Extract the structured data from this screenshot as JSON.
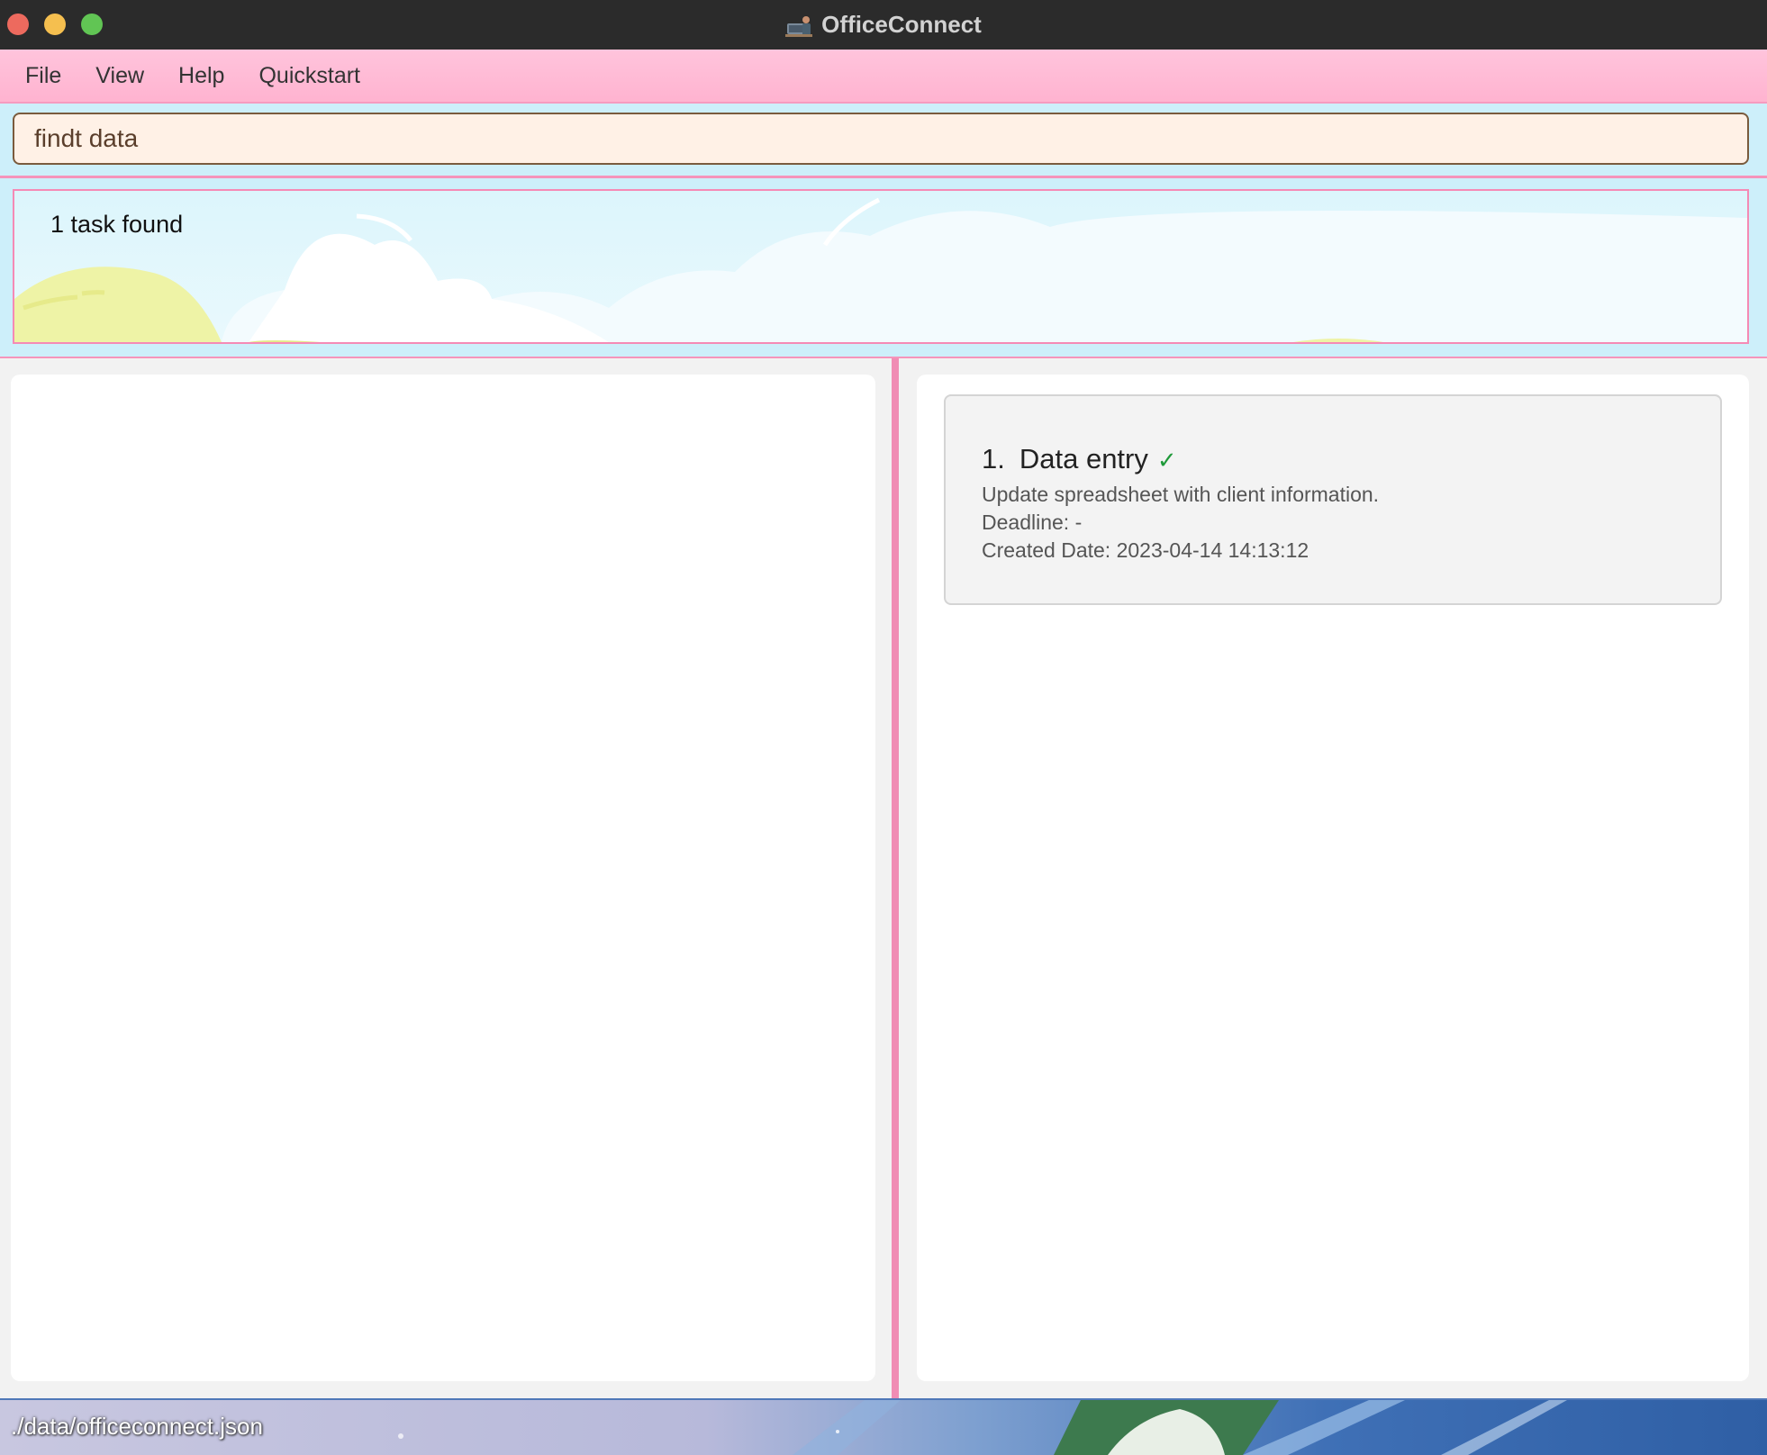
{
  "window": {
    "title": "OfficeConnect"
  },
  "menu": [
    "File",
    "View",
    "Help",
    "Quickstart"
  ],
  "command": {
    "value": "findt data"
  },
  "result": {
    "message": "1 task found"
  },
  "tasks": [
    {
      "index": "1.",
      "title": "Data entry",
      "status_mark": "✓",
      "description": "Update spreadsheet with client information.",
      "deadline": "Deadline: -",
      "created": "Created Date: 2023-04-14 14:13:12"
    }
  ],
  "status": {
    "path": "./data/officeconnect.json"
  },
  "colors": {
    "accent_pink": "#f08db4",
    "command_bg": "#cdeffa",
    "check_green": "#1f9a3a"
  },
  "icons": [
    "close-window-icon",
    "minimize-window-icon",
    "maximize-window-icon",
    "app-logo-icon",
    "check-icon"
  ]
}
